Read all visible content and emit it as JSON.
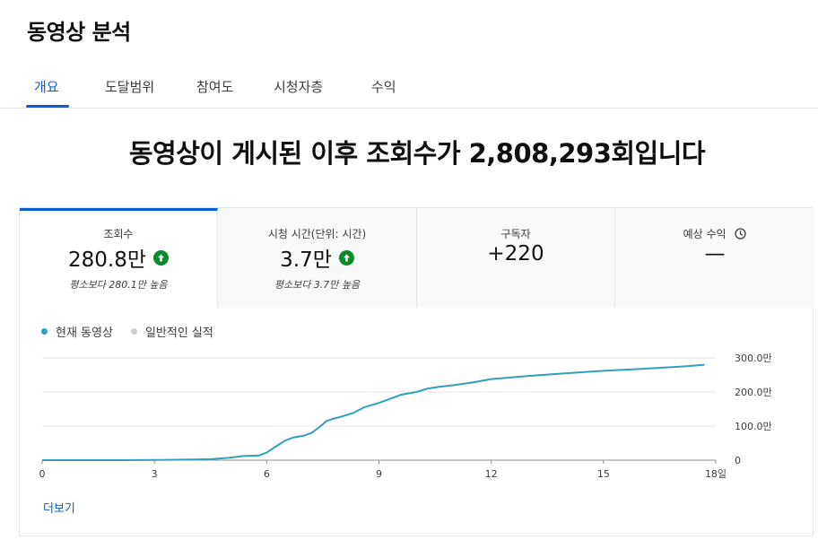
{
  "header": {
    "title": "동영상 분석"
  },
  "tabs": [
    {
      "label": "개요"
    },
    {
      "label": "도달범위"
    },
    {
      "label": "참여도"
    },
    {
      "label": "시청자층"
    },
    {
      "label": "수익"
    }
  ],
  "active_tab": "개요",
  "headline": "동영상이 게시된 이후 조회수가 2,808,293회입니다",
  "metrics": [
    {
      "label": "조회수",
      "value": "280.8만",
      "sub": "평소보다 280.1만 높음",
      "trend": "up",
      "selected": true
    },
    {
      "label": "시청 시간(단위: 시간)",
      "value": "3.7만",
      "sub": "평소보다 3.7만 높음",
      "trend": "up",
      "selected": false
    },
    {
      "label": "구독자",
      "value": "+220",
      "sub": "",
      "selected": false
    },
    {
      "label": "예상 수익",
      "value": "—",
      "sub": "",
      "icon": "clock-icon",
      "selected": false
    }
  ],
  "legend": {
    "current": "현재 동영상",
    "typical": "일반적인 실적"
  },
  "colors": {
    "accent": "#065fd4",
    "series_current": "#2fa1bd",
    "series_typical": "#cccccc",
    "trend_up": "#0b8a2a"
  },
  "more_link": "더보기",
  "chart_data": {
    "type": "line",
    "title": "",
    "xlabel": "",
    "ylabel": "",
    "x_ticks": [
      "0",
      "3",
      "6",
      "9",
      "12",
      "15",
      "18일"
    ],
    "y_ticks": [
      "0",
      "100.0만",
      "200.0만",
      "300.0만"
    ],
    "xlim": [
      0,
      18
    ],
    "ylim": [
      0,
      300
    ],
    "grid": true,
    "series": [
      {
        "name": "현재 동영상",
        "x": [
          0,
          1,
          2,
          3,
          3.4,
          4,
          4.5,
          5,
          5.4,
          5.8,
          6,
          6.2,
          6.5,
          6.7,
          7,
          7.2,
          7.4,
          7.6,
          7.8,
          8,
          8.3,
          8.6,
          9,
          9.3,
          9.6,
          10,
          10.3,
          10.6,
          11,
          11.5,
          12,
          13,
          14,
          15,
          16,
          17,
          17.7
        ],
        "values": [
          0,
          0,
          0,
          0.5,
          1,
          2,
          3,
          7,
          12,
          14,
          22,
          37,
          58,
          66,
          72,
          80,
          96,
          115,
          122,
          128,
          138,
          155,
          168,
          180,
          192,
          200,
          210,
          215,
          220,
          228,
          238,
          247,
          255,
          262,
          268,
          274,
          280
        ]
      }
    ],
    "legend": [
      "현재 동영상",
      "일반적인 실적"
    ],
    "legend_position": "top-left"
  }
}
